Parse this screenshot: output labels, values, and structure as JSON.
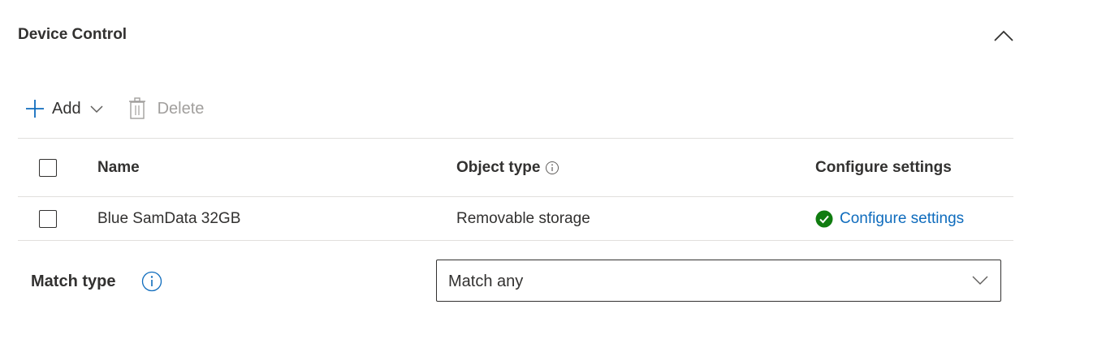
{
  "section": {
    "title": "Device Control"
  },
  "toolbar": {
    "add_label": "Add",
    "delete_label": "Delete"
  },
  "table": {
    "columns": [
      "Name",
      "Object type",
      "Configure settings"
    ],
    "rows": [
      {
        "name": "Blue SamData 32GB",
        "object_type": "Removable storage",
        "configure_link": "Configure settings"
      }
    ]
  },
  "match": {
    "label": "Match type",
    "selected": "Match any"
  },
  "colors": {
    "accent": "#0f6cbd",
    "success": "#107c10",
    "disabled": "#a19f9d",
    "text": "#323130",
    "border": "#e1dfdd"
  },
  "icons": {
    "collapse": "chevron-up-icon",
    "add": "plus-icon",
    "add_menu": "chevron-down-icon",
    "delete": "trash-icon",
    "info": "info-icon",
    "status": "checkmark-circle-icon",
    "select": "chevron-down-icon"
  }
}
